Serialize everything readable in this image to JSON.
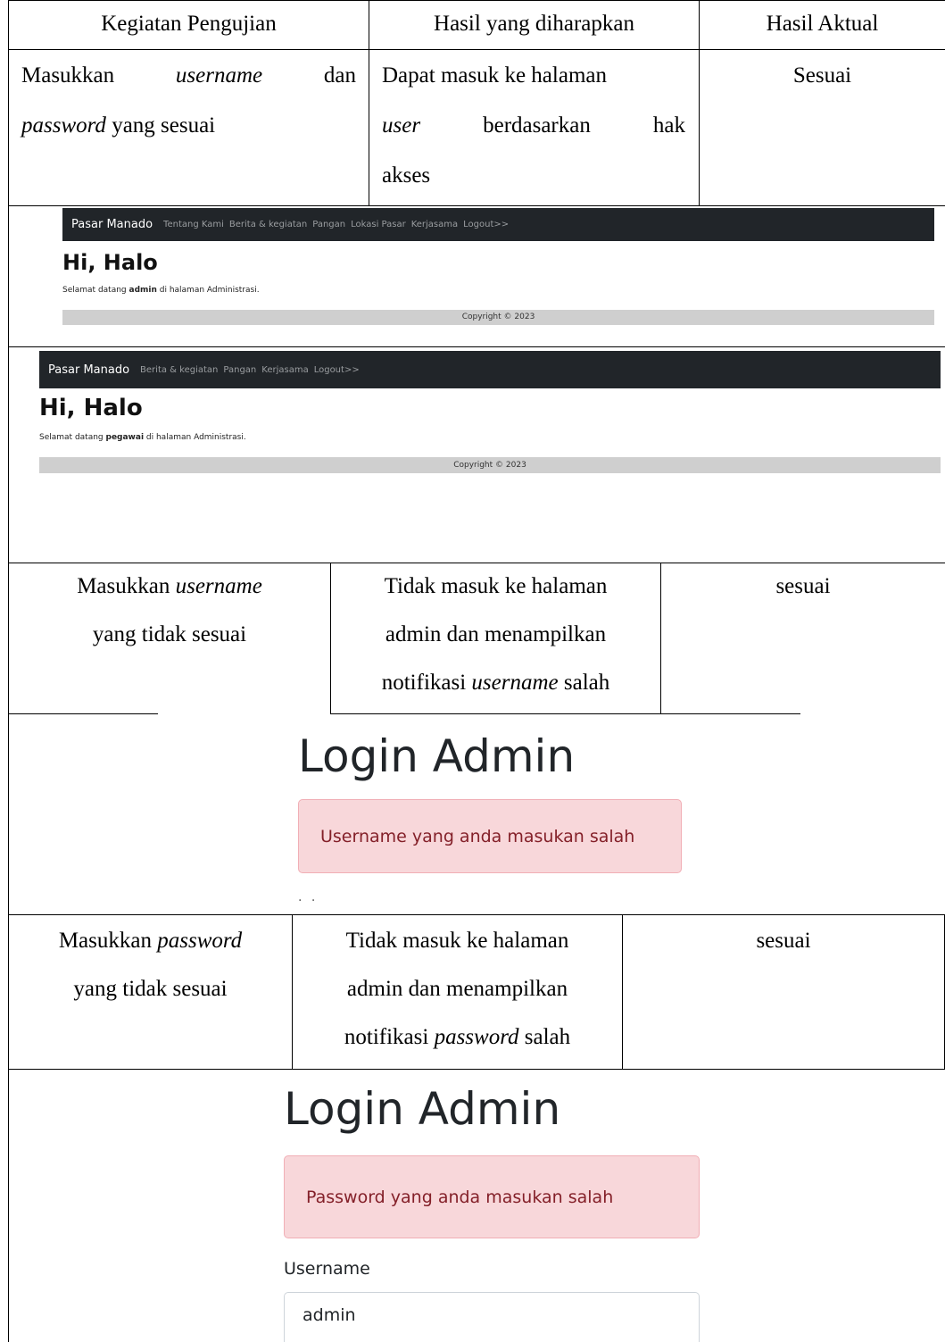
{
  "table1": {
    "headers": [
      "Kegiatan Pengujian",
      "Hasil yang diharapkan",
      "Hasil Aktual"
    ],
    "row1": {
      "activity_a": "Masukkan",
      "activity_b": "username",
      "activity_c": "dan",
      "activity_d": "password",
      "activity_e": "yang sesuai",
      "expected_a": "Dapat masuk ke halaman",
      "expected_b": "user",
      "expected_c": "berdasarkan",
      "expected_d": "hak",
      "expected_e": "akses",
      "actual": "Sesuai"
    }
  },
  "screen_admin": {
    "brand": "Pasar Manado",
    "nav": [
      "Tentang Kami",
      "Berita & kegiatan",
      "Pangan",
      "Lokasi Pasar",
      "Kerjasama",
      "Logout>>"
    ],
    "heading": "Hi, Halo",
    "welcome_pre": "Selamat datang ",
    "welcome_user": "admin",
    "welcome_post": " di halaman Administrasi.",
    "footer": "Copyright © 2023"
  },
  "screen_pegawai": {
    "brand": "Pasar Manado",
    "nav": [
      "Berita & kegiatan",
      "Pangan",
      "Kerjasama",
      "Logout>>"
    ],
    "heading": "Hi, Halo",
    "welcome_pre": "Selamat datang ",
    "welcome_user": "pegawai",
    "welcome_post": " di halaman Administrasi.",
    "footer": "Copyright © 2023"
  },
  "table2": {
    "activity_a": "Masukkan ",
    "activity_b": "username",
    "activity_c": "yang tidak sesuai",
    "expected_a": "Tidak masuk ke halaman",
    "expected_b": "admin dan menampilkan",
    "expected_c": "notifikasi ",
    "expected_d": "username",
    "expected_e": " salah",
    "actual": "sesuai"
  },
  "login_username_error": {
    "title": "Login Admin",
    "alert": "Username yang anda masukan salah",
    "dots": ". ."
  },
  "table3": {
    "activity_a": "Masukkan ",
    "activity_b": "password",
    "activity_c": "yang tidak sesuai",
    "expected_a": "Tidak masuk ke halaman",
    "expected_b": "admin dan menampilkan",
    "expected_c": "notifikasi ",
    "expected_d": "password",
    "expected_e": " salah",
    "actual": "sesuai"
  },
  "login_password_error": {
    "title": "Login Admin",
    "alert": "Password yang anda masukan salah",
    "username_label": "Username",
    "username_value": "admin"
  }
}
